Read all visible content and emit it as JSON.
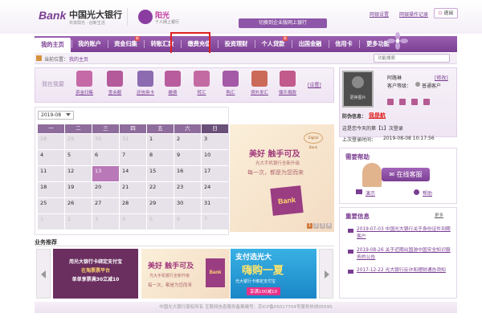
{
  "header": {
    "logo_mark": "Bank",
    "bank_name": "中国光大银行",
    "slogan": "共享阳光 · 创新生活",
    "sub_brand": "阳光",
    "sub_brand_caption": "个人网上银行",
    "switch_label": "切换到企业版网上银行",
    "links": [
      "网银设置",
      "网银操作记录",
      "退出"
    ]
  },
  "nav": {
    "items": [
      {
        "label": "我的主页",
        "badge": ""
      },
      {
        "label": "我的账户",
        "badge": ""
      },
      {
        "label": "资金归集",
        "badge": "新"
      },
      {
        "label": "转账汇款",
        "badge": ""
      },
      {
        "label": "缴费充值",
        "badge": ""
      },
      {
        "label": "投资理财",
        "badge": ""
      },
      {
        "label": "个人贷款",
        "badge": "新"
      },
      {
        "label": "出国金融",
        "badge": ""
      },
      {
        "label": "信用卡",
        "badge": ""
      },
      {
        "label": "更多功能",
        "badge": ""
      }
    ],
    "active_index": 0
  },
  "breadcrumb": {
    "label": "当前位置：",
    "current": "我的主页",
    "search_placeholder": "功能搜索"
  },
  "quick": {
    "title": "我在我要",
    "items": [
      {
        "label": "资金归集",
        "icon": "funds-icon",
        "color": "#c56aa6"
      },
      {
        "label": "查余额",
        "icon": "balance-icon",
        "color": "#b45a9a"
      },
      {
        "label": "还信用卡",
        "icon": "credit-card-icon",
        "color": "#8c6bb0"
      },
      {
        "label": "缴费",
        "icon": "payment-icon",
        "color": "#b85c9d"
      },
      {
        "label": "转汇",
        "icon": "transfer-icon",
        "color": "#c46aa3"
      },
      {
        "label": "购汇",
        "icon": "exchange-icon",
        "color": "#a45aa6"
      },
      {
        "label": "境外发汇",
        "icon": "remit-icon",
        "color": "#cc6a5a"
      },
      {
        "label": "慷乐捐款",
        "icon": "donate-icon",
        "color": "#c25a8c"
      }
    ],
    "set_label": "[设置]"
  },
  "calendar": {
    "month": "2019-08",
    "weekdays": [
      "一",
      "二",
      "三",
      "四",
      "五",
      "六",
      "日"
    ],
    "weeks": [
      [
        "28",
        "29",
        "30",
        "31",
        "1",
        "2",
        "3"
      ],
      [
        "4",
        "5",
        "6",
        "7",
        "8",
        "9",
        "10"
      ],
      [
        "11",
        "12",
        "13",
        "14",
        "15",
        "16",
        "17"
      ],
      [
        "18",
        "19",
        "20",
        "21",
        "22",
        "23",
        "24"
      ],
      [
        "25",
        "26",
        "27",
        "28",
        "29",
        "30",
        "31"
      ],
      [
        "1",
        "2",
        "3",
        "4",
        "5",
        "6",
        "7"
      ]
    ],
    "today": "13"
  },
  "promo": {
    "logo": "Digital Bank",
    "headline": "美好 触手可及",
    "sub": "光大手机银行全新升级",
    "tagline": "每一次，都是为您而来",
    "card_text": "Bank",
    "pager": [
      "1",
      "2",
      "3",
      "4"
    ]
  },
  "business": {
    "title": "业务推荐",
    "ad1_lines": [
      "用光大银行卡绑定支付宝",
      "在淘票票平台",
      "单单享票满30立减10"
    ],
    "ad2_headline": "美好 触手可及",
    "ad2_sub": "光大手机银行全新升级",
    "ad2_tagline": "每一次，都是为您而来",
    "ad3_top": "支付选光大",
    "ad3_main": "嗨购一夏",
    "ad3_sub": "光大银行卡绑定支付宝",
    "ad3_foot": "享满100减10"
  },
  "user": {
    "avatar_label": "更换图片",
    "name": "阿路琳",
    "name_link": "[修改]",
    "level_label": "客户等级：",
    "level": "普通客户",
    "fraud_label": "防伪信息：",
    "fraud_value": "我是航",
    "login_count": "这是您今天的第【1】次登录",
    "last_login_label": "上次登录时间：",
    "last_login": "2019-08-08 10:17:56"
  },
  "help": {
    "title": "需要帮助",
    "cs_label": "在线客服",
    "demo_label": "演示",
    "help_label": "帮助"
  },
  "news": {
    "title": "重要信息",
    "more": "更多",
    "items": [
      "2019-07-03 中国光大银行关于身份证件到期客户",
      "2019-08-26 关于近期出国游中国安全知识服务的公告",
      "2017-12-22 光大银行反诈和理财通告须知"
    ]
  },
  "footer": {
    "text": "中国光大银行版权所有 互联网信息服务备案编号：京ICP备05017704号服务热线95595"
  }
}
